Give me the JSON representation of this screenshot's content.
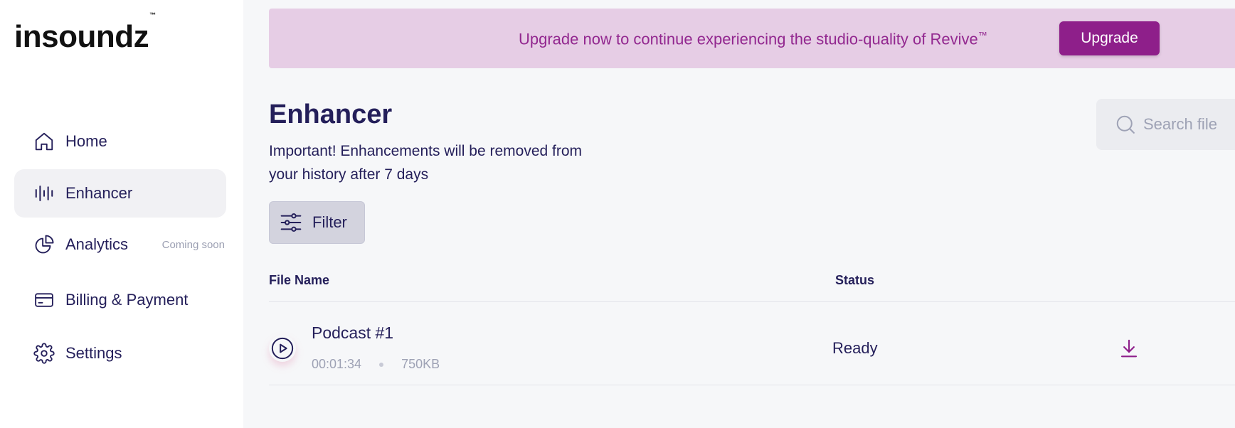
{
  "brand": {
    "logo_text": "insoundz",
    "trademark": "™"
  },
  "sidebar": {
    "items": [
      {
        "label": "Home",
        "icon": "home-icon"
      },
      {
        "label": "Enhancer",
        "icon": "waveform-icon",
        "active": true
      },
      {
        "label": "Analytics",
        "icon": "pie-chart-icon",
        "badge": "Coming soon"
      },
      {
        "label": "Billing & Payment",
        "icon": "credit-card-icon"
      },
      {
        "label": "Settings",
        "icon": "gear-icon"
      }
    ]
  },
  "banner": {
    "text": "Upgrade now to continue experiencing the studio-quality of Revive",
    "trademark": "™",
    "button_label": "Upgrade"
  },
  "main": {
    "title": "Enhancer",
    "notice": "Important! Enhancements will be removed from your history after 7 days",
    "search_placeholder": "Search file",
    "filter_label": "Filter"
  },
  "table": {
    "columns": [
      "File Name",
      "Status"
    ],
    "rows": [
      {
        "name": "Podcast #1",
        "duration": "00:01:34",
        "size": "750KB",
        "status": "Ready"
      }
    ]
  },
  "colors": {
    "accent": "#8e1f8a",
    "banner_bg": "#e6cde5",
    "banner_text": "#92278f",
    "text_primary": "#241f5a",
    "active_nav_bg": "#f1f1f4"
  }
}
